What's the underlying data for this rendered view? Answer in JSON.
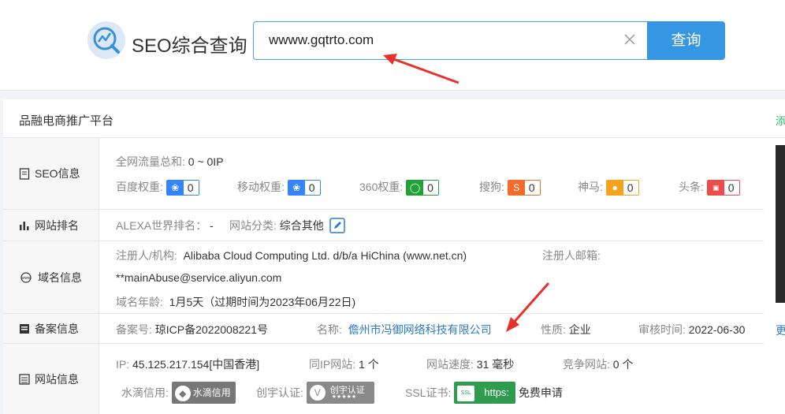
{
  "header": {
    "logo_title": "SEO综合查询",
    "search_value": "wwww.gqtrto.com",
    "search_button": "查询"
  },
  "panel": {
    "title": "品融电商推广平台",
    "add_link": "添"
  },
  "seo": {
    "label": "SEO信息",
    "traffic_label": "全网流量总和:",
    "traffic_value": "0 ~ 0IP",
    "weights": [
      {
        "label": "百度权重:",
        "value": "0",
        "color": "#3385ff",
        "icon": "baidu-paw-icon"
      },
      {
        "label": "移动权重:",
        "value": "0",
        "color": "#3385ff",
        "icon": "mobile-paw-icon"
      },
      {
        "label": "360权重:",
        "value": "0",
        "color": "#1fa336",
        "icon": "360-icon"
      },
      {
        "label": "搜狗:",
        "value": "0",
        "color": "#f56a2a",
        "icon": "sogou-icon"
      },
      {
        "label": "神马:",
        "value": "0",
        "color": "#f7a21b",
        "icon": "shenma-icon"
      },
      {
        "label": "头条:",
        "value": "0",
        "color": "#f04b4b",
        "icon": "toutiao-icon"
      }
    ]
  },
  "rank": {
    "label": "网站排名",
    "alexa_label": "ALEXA世界排名：",
    "alexa_value": "-",
    "category_label": "网站分类:",
    "category_value": "综合其他"
  },
  "domain": {
    "label": "域名信息",
    "registrant_label": "注册人/机构:",
    "registrant_value": "Alibaba Cloud Computing Ltd. d/b/a HiChina (www.net.cn)",
    "email_label": "注册人邮箱:",
    "email_value": "**mainAbuse@service.aliyun.com",
    "age_label": "域名年龄:",
    "age_value": "1月5天（过期时间为2023年06月22日)"
  },
  "icp": {
    "label": "备案信息",
    "number_label": "备案号:",
    "number_value": "琼ICP备2022008221号",
    "name_label": "名称:",
    "name_value": "儋州市冯御网络科技有限公司",
    "type_label": "性质:",
    "type_value": "企业",
    "date_label": "审核时间:",
    "date_value": "2022-06-30",
    "more": "更"
  },
  "site": {
    "label": "网站信息",
    "ip_label": "IP:",
    "ip_value": "45.125.217.154[中国香港]",
    "sameip_label": "同IP网站:",
    "sameip_value": "1 个",
    "speed_label": "网站速度:",
    "speed_value": "31 毫秒",
    "compete_label": "竞争网站:",
    "compete_value": "0 个",
    "shuidi_label": "水滴信用:",
    "shuidi_badge": "水滴信用",
    "chuangyu_label": "创宇认证:",
    "chuangyu_badge": "创宇认证",
    "chuangyu_stars": "★★★★★",
    "ssl_label": "SSL证书:",
    "ssl_badge": "https:",
    "ssl_free": "免费申请"
  }
}
